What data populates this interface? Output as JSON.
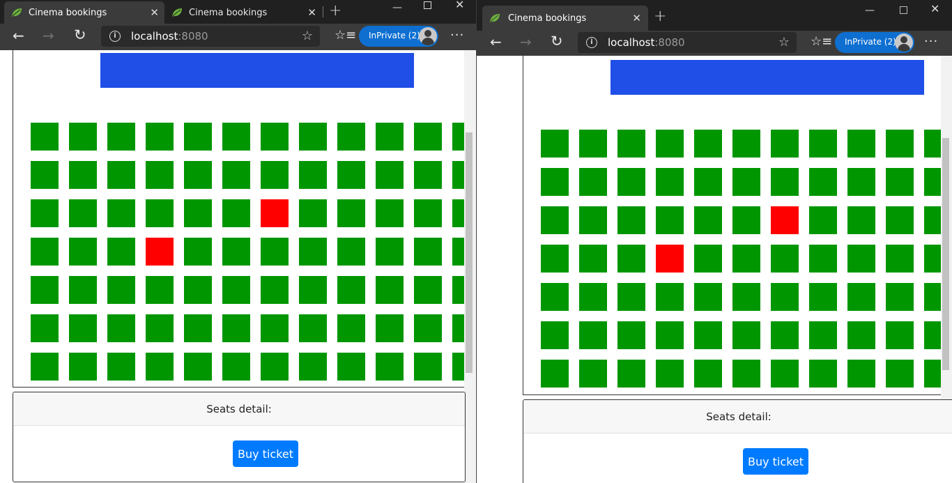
{
  "accent_colors": {
    "seat_free": "#009600",
    "seat_taken": "#ff0000",
    "screen": "#1f4fe6",
    "button": "#007bff",
    "inprivate": "#0e6fd1"
  },
  "icons": {
    "favicon": "spring-leaf-icon",
    "close": "close-icon",
    "new_tab": "plus-icon",
    "back": "back-arrow-icon",
    "forward": "forward-arrow-icon",
    "refresh": "refresh-icon",
    "info": "info-icon",
    "favorite": "star-icon",
    "favorites": "favorites-icon",
    "more": "more-icon",
    "avatar": "avatar-icon",
    "minimize": "minimize-icon",
    "maximize": "maximize-icon"
  },
  "left": {
    "tabs": [
      {
        "title": "Cinema bookings"
      },
      {
        "title": "Cinema bookings"
      }
    ],
    "address": {
      "host": "localhost",
      "port": ":8080"
    },
    "inprivate": "InPrivate (2)",
    "seat_grid": {
      "taken": [
        [
          2,
          6
        ],
        [
          3,
          3
        ]
      ],
      "rows": 7,
      "columns": 12
    },
    "details": {
      "header": "Seats detail:",
      "buy_label": "Buy ticket"
    }
  },
  "right": {
    "tabs": [
      {
        "title": "Cinema bookings"
      }
    ],
    "address": {
      "host": "localhost",
      "port": ":8080"
    },
    "inprivate": "InPrivate (2)",
    "seat_grid": {
      "taken": [
        [
          2,
          6
        ],
        [
          3,
          3
        ]
      ],
      "rows": 7,
      "columns": 11
    },
    "details": {
      "header": "Seats detail:",
      "buy_label": "Buy ticket"
    }
  }
}
